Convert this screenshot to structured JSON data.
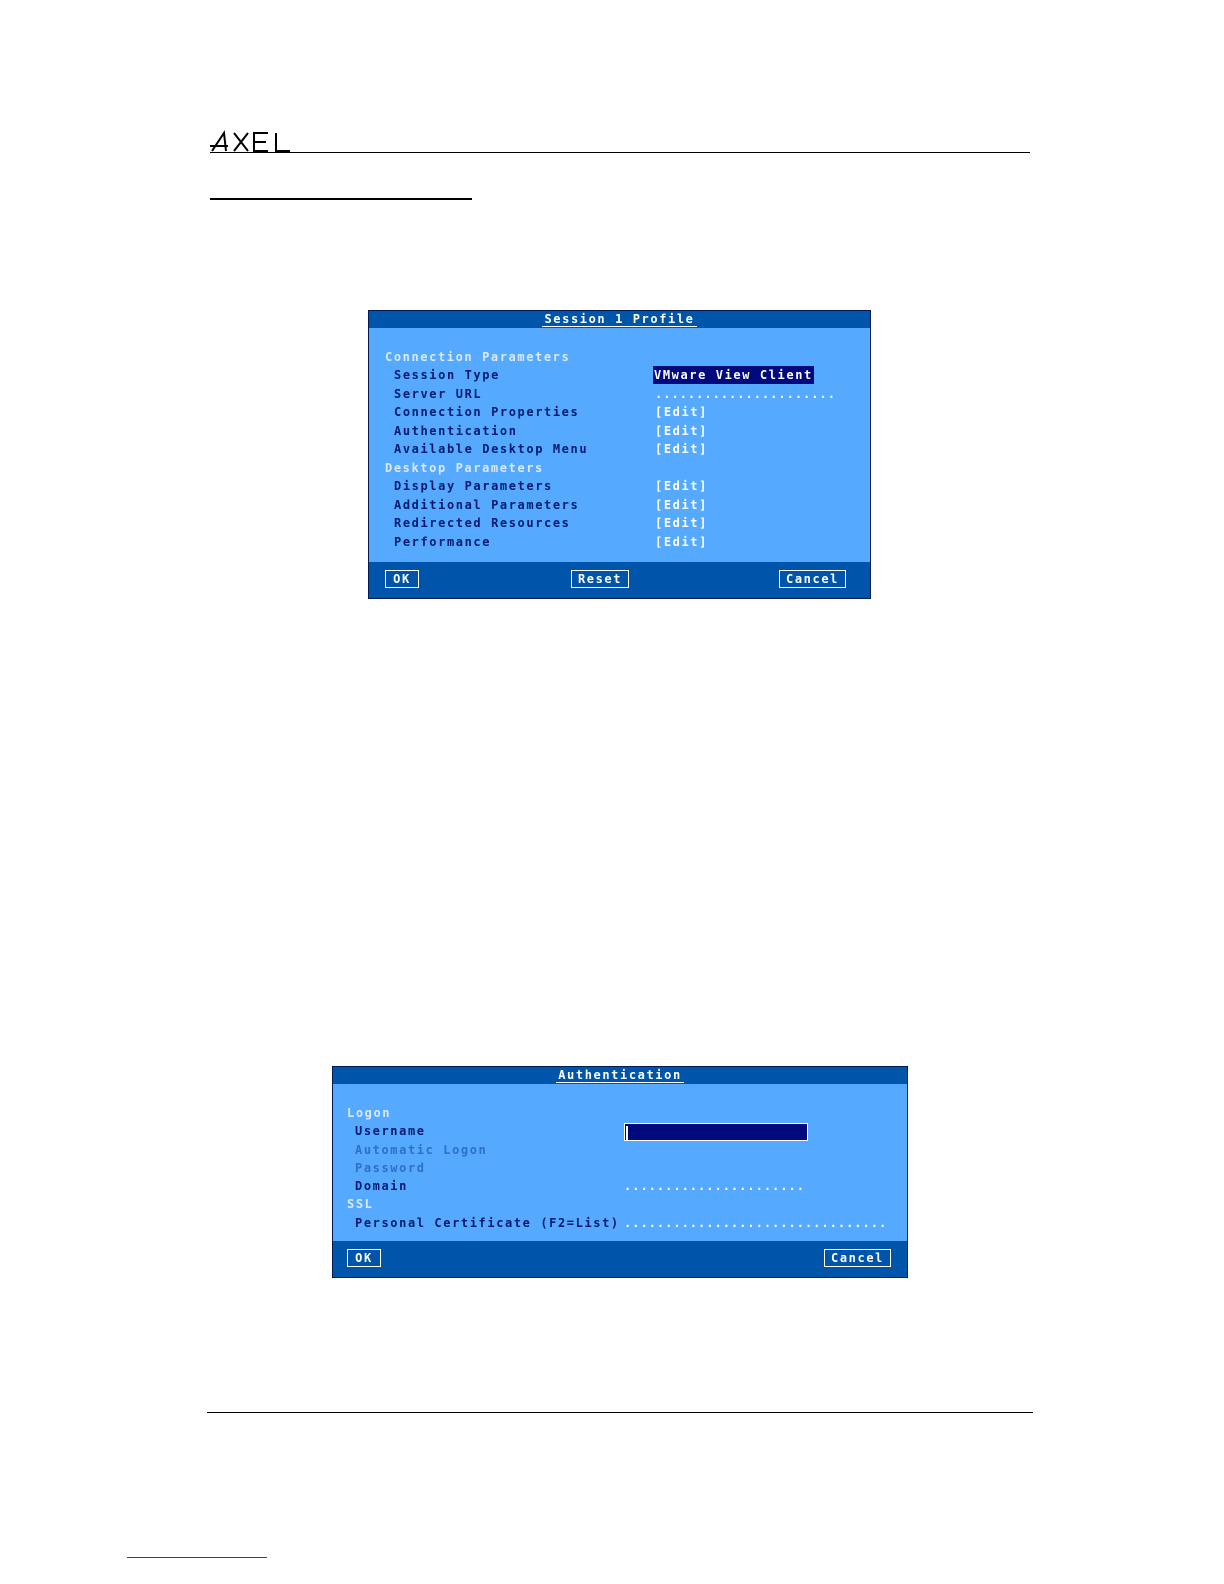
{
  "header": {
    "logo_text": "AXEL"
  },
  "session_dialog": {
    "title": "Session 1 Profile",
    "sections": [
      {
        "heading": "Connection Parameters",
        "rows": [
          {
            "label": "Session Type",
            "value": "VMware View Client"
          },
          {
            "label": "Server URL",
            "value": "......................"
          },
          {
            "label": "Connection Properties",
            "value": "[Edit]"
          },
          {
            "label": "Authentication",
            "value": "[Edit]"
          },
          {
            "label": "Available Desktop Menu",
            "value": "[Edit]"
          }
        ]
      },
      {
        "heading": "Desktop Parameters",
        "rows": [
          {
            "label": "Display Parameters",
            "value": "[Edit]"
          },
          {
            "label": "Additional Parameters",
            "value": "[Edit]"
          },
          {
            "label": "Redirected Resources",
            "value": "[Edit]"
          },
          {
            "label": "Performance",
            "value": "[Edit]"
          }
        ]
      }
    ],
    "buttons": {
      "ok": "OK",
      "reset": "Reset",
      "cancel": "Cancel"
    }
  },
  "auth_dialog": {
    "title": "Authentication",
    "logon_heading": "Logon",
    "username_label": "Username",
    "username_value": "",
    "auto_logon_label": "Automatic Logon",
    "password_label": "Password",
    "domain_label": "Domain",
    "domain_value": "......................",
    "ssl_heading": "SSL",
    "cert_label": "Personal Certificate (F2=List)",
    "cert_value": "................................",
    "buttons": {
      "ok": "OK",
      "cancel": "Cancel"
    }
  },
  "colors": {
    "dialog_bg": "#55aaff",
    "title_bar": "#0055aa",
    "selection": "#000a7d",
    "label_text": "#001b6e"
  }
}
